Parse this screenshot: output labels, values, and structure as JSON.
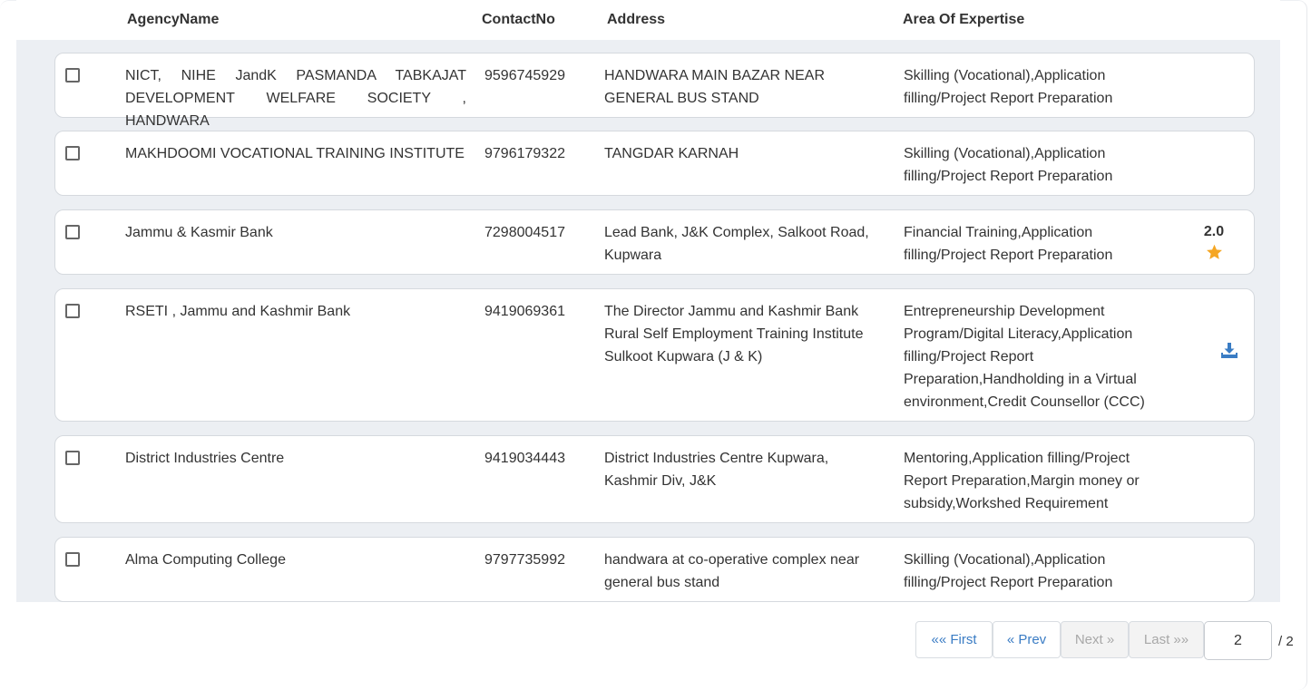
{
  "table": {
    "headers": {
      "agency_name": "AgencyName",
      "contact_no": "ContactNo",
      "address": "Address",
      "area_of_expertise": "Area Of Expertise"
    },
    "rows": [
      {
        "agency_name": "NICT, NIHE JandK PASMANDA TABKAJAT DEVELOPMENT WELFARE SOCIETY , HANDWARA",
        "contact_no": "9596745929",
        "address": "HANDWARA MAIN BAZAR NEAR GENERAL BUS STAND",
        "area_of_expertise": "Skilling (Vocational),Application filling/Project Report Preparation",
        "checked": false
      },
      {
        "agency_name": "MAKHDOOMI VOCATIONAL TRAINING INSTITUTE",
        "contact_no": "9796179322",
        "address": "TANGDAR KARNAH",
        "area_of_expertise": "Skilling (Vocational),Application filling/Project Report Preparation",
        "checked": false
      },
      {
        "agency_name": "Jammu & Kasmir Bank",
        "contact_no": "7298004517",
        "address": "Lead Bank, J&K Complex, Salkoot Road, Kupwara",
        "area_of_expertise": "Financial Training,Application filling/Project Report Preparation",
        "rating": "2.0",
        "rating_icon": "star-icon",
        "checked": false
      },
      {
        "agency_name": "RSETI , Jammu and Kashmir Bank",
        "contact_no": "9419069361",
        "address": "The Director Jammu and Kashmir Bank Rural Self Employment Training Institute Sulkoot Kupwara (J & K)",
        "area_of_expertise": "Entrepreneurship Development Program/Digital Literacy,Application filling/Project Report Preparation,Handholding in a Virtual environment,Credit Counsellor (CCC)",
        "action_icon": "download-icon",
        "checked": false
      },
      {
        "agency_name": "District Industries Centre",
        "contact_no": "9419034443",
        "address": "District Industries Centre Kupwara, Kashmir Div, J&K",
        "area_of_expertise": "Mentoring,Application filling/Project Report Preparation,Margin money or subsidy,Workshed Requirement",
        "checked": false
      },
      {
        "agency_name": "Alma Computing College",
        "contact_no": "9797735992",
        "address": "handwara at co-operative complex near general bus stand",
        "area_of_expertise": "Skilling (Vocational),Application filling/Project Report Preparation",
        "checked": false
      }
    ]
  },
  "pagination": {
    "first_label": "«« First",
    "prev_label": "« Prev",
    "next_label": "Next »",
    "last_label": "Last »»",
    "current_page": "2",
    "total_label": "/ 2"
  },
  "colors": {
    "link_blue": "#3a7cc4",
    "star": "#f5a623",
    "list_background": "#eceff3"
  }
}
